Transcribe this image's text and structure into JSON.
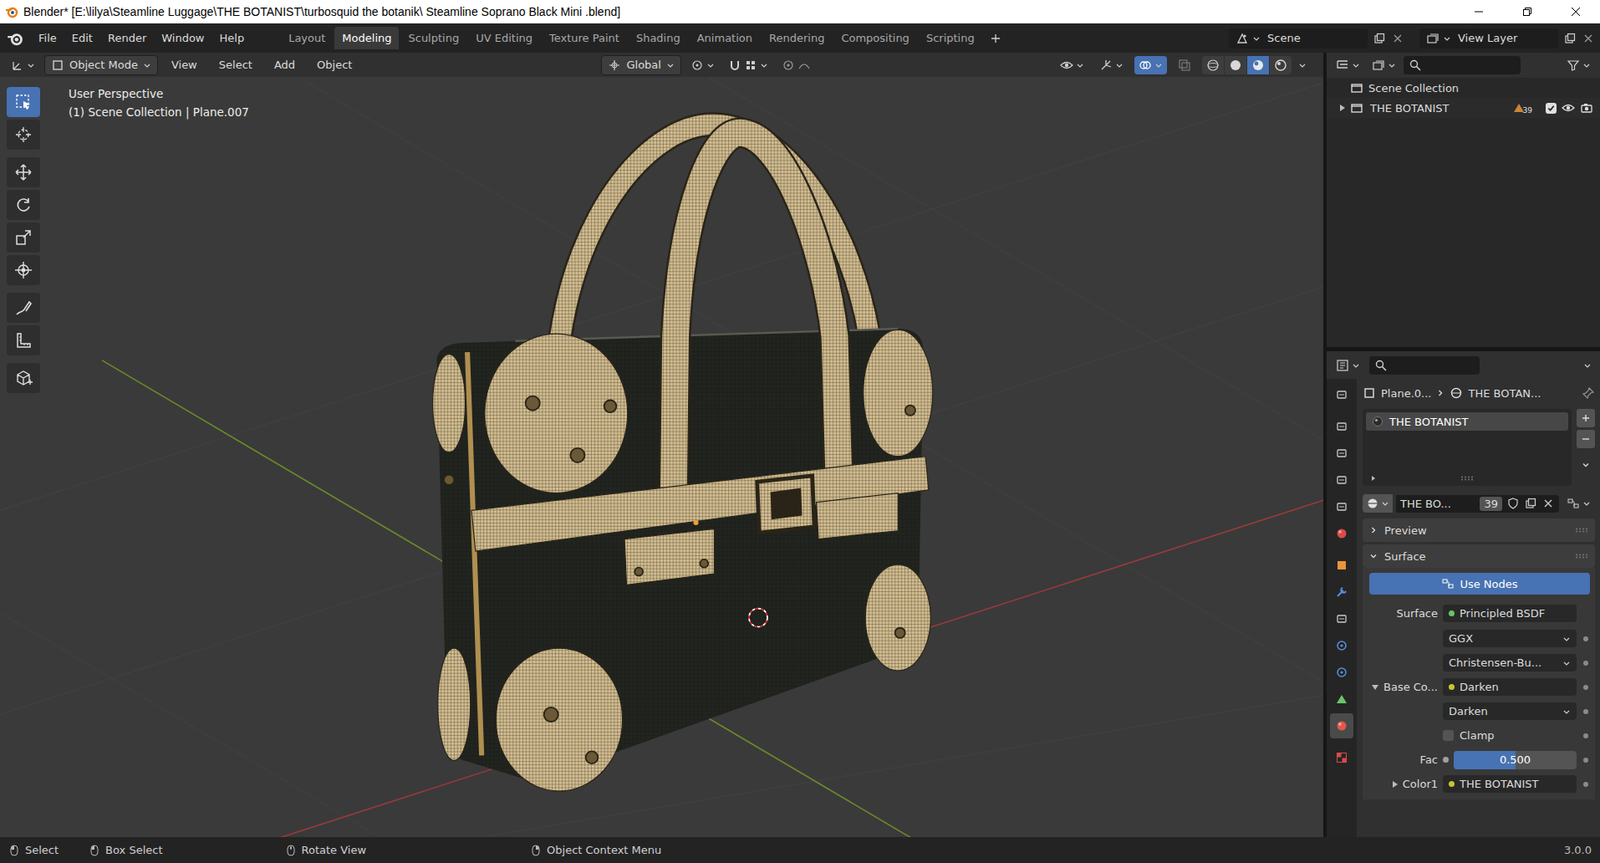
{
  "window": {
    "title": "Blender* [E:\\lilya\\Steamline Luggage\\THE BOTANIST\\turbosquid the botanik\\ Steamline Soprano Black Mini .blend]"
  },
  "menu": [
    "File",
    "Edit",
    "Render",
    "Window",
    "Help"
  ],
  "workspaces": [
    {
      "label": "Layout",
      "selected": false
    },
    {
      "label": "Modeling",
      "selected": true
    },
    {
      "label": "Sculpting",
      "selected": false
    },
    {
      "label": "UV Editing",
      "selected": false
    },
    {
      "label": "Texture Paint",
      "selected": false
    },
    {
      "label": "Shading",
      "selected": false
    },
    {
      "label": "Animation",
      "selected": false
    },
    {
      "label": "Rendering",
      "selected": false
    },
    {
      "label": "Compositing",
      "selected": false
    },
    {
      "label": "Scripting",
      "selected": false
    }
  ],
  "scene": "Scene",
  "view_layer": "View Layer",
  "viewport_header": {
    "mode": "Object Mode",
    "menus": [
      "View",
      "Select",
      "Add",
      "Object"
    ],
    "orientation": "Global",
    "overlays_on": true,
    "shading_modes": [
      {
        "selected": false
      },
      {
        "selected": false
      },
      {
        "selected": true
      },
      {
        "selected": false
      }
    ]
  },
  "viewport": {
    "perspective": "User Perspective",
    "context": "(1) Scene Collection | Plane.007"
  },
  "tools": [
    {
      "selected": true
    },
    {
      "selected": false
    },
    {
      "selected": false
    },
    {
      "selected": false
    },
    {
      "selected": false
    },
    {
      "selected": false
    },
    {
      "selected": false
    },
    {
      "selected": false
    },
    {
      "selected": false
    }
  ],
  "outliner": {
    "root": "Scene Collection",
    "items": [
      {
        "name": "THE BOTANIST",
        "expanded": false,
        "count": "39",
        "checked": true,
        "visible": true,
        "renderable": true
      }
    ]
  },
  "properties": {
    "tabs": [
      {
        "selected": false
      },
      {
        "selected": false
      },
      {
        "selected": false
      },
      {
        "selected": false
      },
      {
        "selected": false
      },
      {
        "selected": false
      },
      {
        "selected": false
      },
      {
        "selected": false
      },
      {
        "selected": false
      },
      {
        "selected": false
      },
      {
        "selected": false
      },
      {
        "selected": false
      },
      {
        "selected": true
      },
      {
        "selected": false
      }
    ],
    "breadcrumb": [
      "Plane.0...",
      "THE BOTAN..."
    ],
    "slots": [
      {
        "name": "THE BOTANIST",
        "selected": true
      }
    ],
    "material": {
      "name": "THE BO...",
      "users": "39"
    },
    "panels": [
      {
        "label": "Preview",
        "expanded": false
      },
      {
        "label": "Surface",
        "expanded": true
      }
    ],
    "use_nodes": {
      "label": "Use Nodes",
      "on": true
    },
    "surface": {
      "label": "Surface",
      "value": "Principled BSDF",
      "color": "#63c763"
    },
    "fields": [
      {
        "kind": "dropdown",
        "label": "",
        "value": "GGX"
      },
      {
        "kind": "dropdown",
        "label": "",
        "value": "Christensen-Bu..."
      },
      {
        "kind": "link",
        "label": "Base Co...",
        "value": "Darken",
        "expanded": true,
        "color": "#c7c729"
      },
      {
        "kind": "dropdown",
        "label": "",
        "value": "Darken"
      },
      {
        "kind": "checkbox",
        "label": "",
        "value": "Clamp",
        "checked": false
      },
      {
        "kind": "slider",
        "label": "Fac",
        "value": "0.500",
        "level": 0.5,
        "color": "#a1a1a1"
      },
      {
        "kind": "link",
        "label": "Color1",
        "value": "THE BOTANIST",
        "expanded": false,
        "color": "#c7c729"
      }
    ]
  },
  "status_bar": {
    "items": [
      "Select",
      "Box Select",
      "Rotate View",
      "Object Context Menu"
    ],
    "version": "3.0.0"
  }
}
